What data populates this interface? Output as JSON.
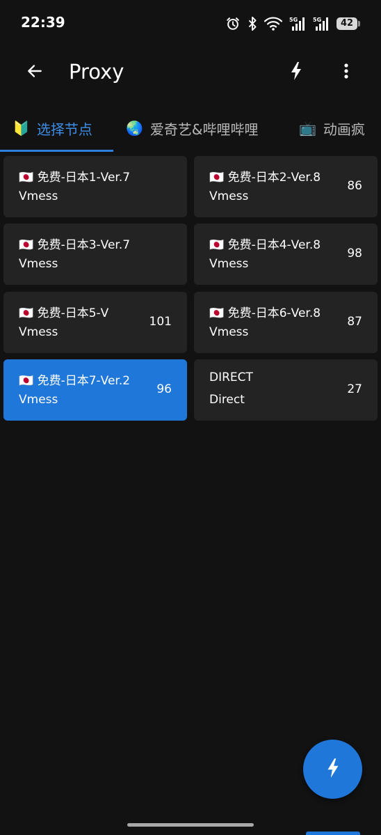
{
  "status_bar": {
    "time": "22:39",
    "battery": "42",
    "icons": [
      "alarm-icon",
      "bluetooth-icon",
      "wifi-icon",
      "signal-5g-icon",
      "signal-5g-icon",
      "battery-icon"
    ]
  },
  "app_bar": {
    "title": "Proxy",
    "icons": [
      "back-arrow-icon",
      "lightning-icon",
      "more-vert-icon"
    ]
  },
  "tabs": [
    {
      "emoji": "🔰",
      "label": "选择节点",
      "active": true
    },
    {
      "emoji": "🌏",
      "label": "爱奇艺&哔哩哔哩",
      "active": false
    },
    {
      "emoji": "📺",
      "label": "动画疯",
      "active": false
    }
  ],
  "proxies": [
    {
      "flag": "🇯🇵",
      "name": "免费-日本1-Ver.7",
      "type": "Vmess",
      "delay": "",
      "selected": false
    },
    {
      "flag": "🇯🇵",
      "name": "免费-日本2-Ver.8",
      "type": "Vmess",
      "delay": "86",
      "selected": false
    },
    {
      "flag": "🇯🇵",
      "name": "免费-日本3-Ver.7",
      "type": "Vmess",
      "delay": "",
      "selected": false
    },
    {
      "flag": "🇯🇵",
      "name": "免费-日本4-Ver.8",
      "type": "Vmess",
      "delay": "98",
      "selected": false
    },
    {
      "flag": "🇯🇵",
      "name": "免费-日本5-V",
      "type": "Vmess",
      "delay": "101",
      "selected": false
    },
    {
      "flag": "🇯🇵",
      "name": "免费-日本6-Ver.8",
      "type": "Vmess",
      "delay": "87",
      "selected": false
    },
    {
      "flag": "🇯🇵",
      "name": "免费-日本7-Ver.2",
      "type": "Vmess",
      "delay": "96",
      "selected": true
    },
    {
      "flag": "",
      "name": "DIRECT",
      "type": "Direct",
      "delay": "27",
      "selected": false
    }
  ],
  "fab": {
    "icon": "lightning-icon"
  },
  "colors": {
    "background": "#121212",
    "card": "#232323",
    "accent": "#1f77d9",
    "active_tab": "#3e8ee8"
  }
}
